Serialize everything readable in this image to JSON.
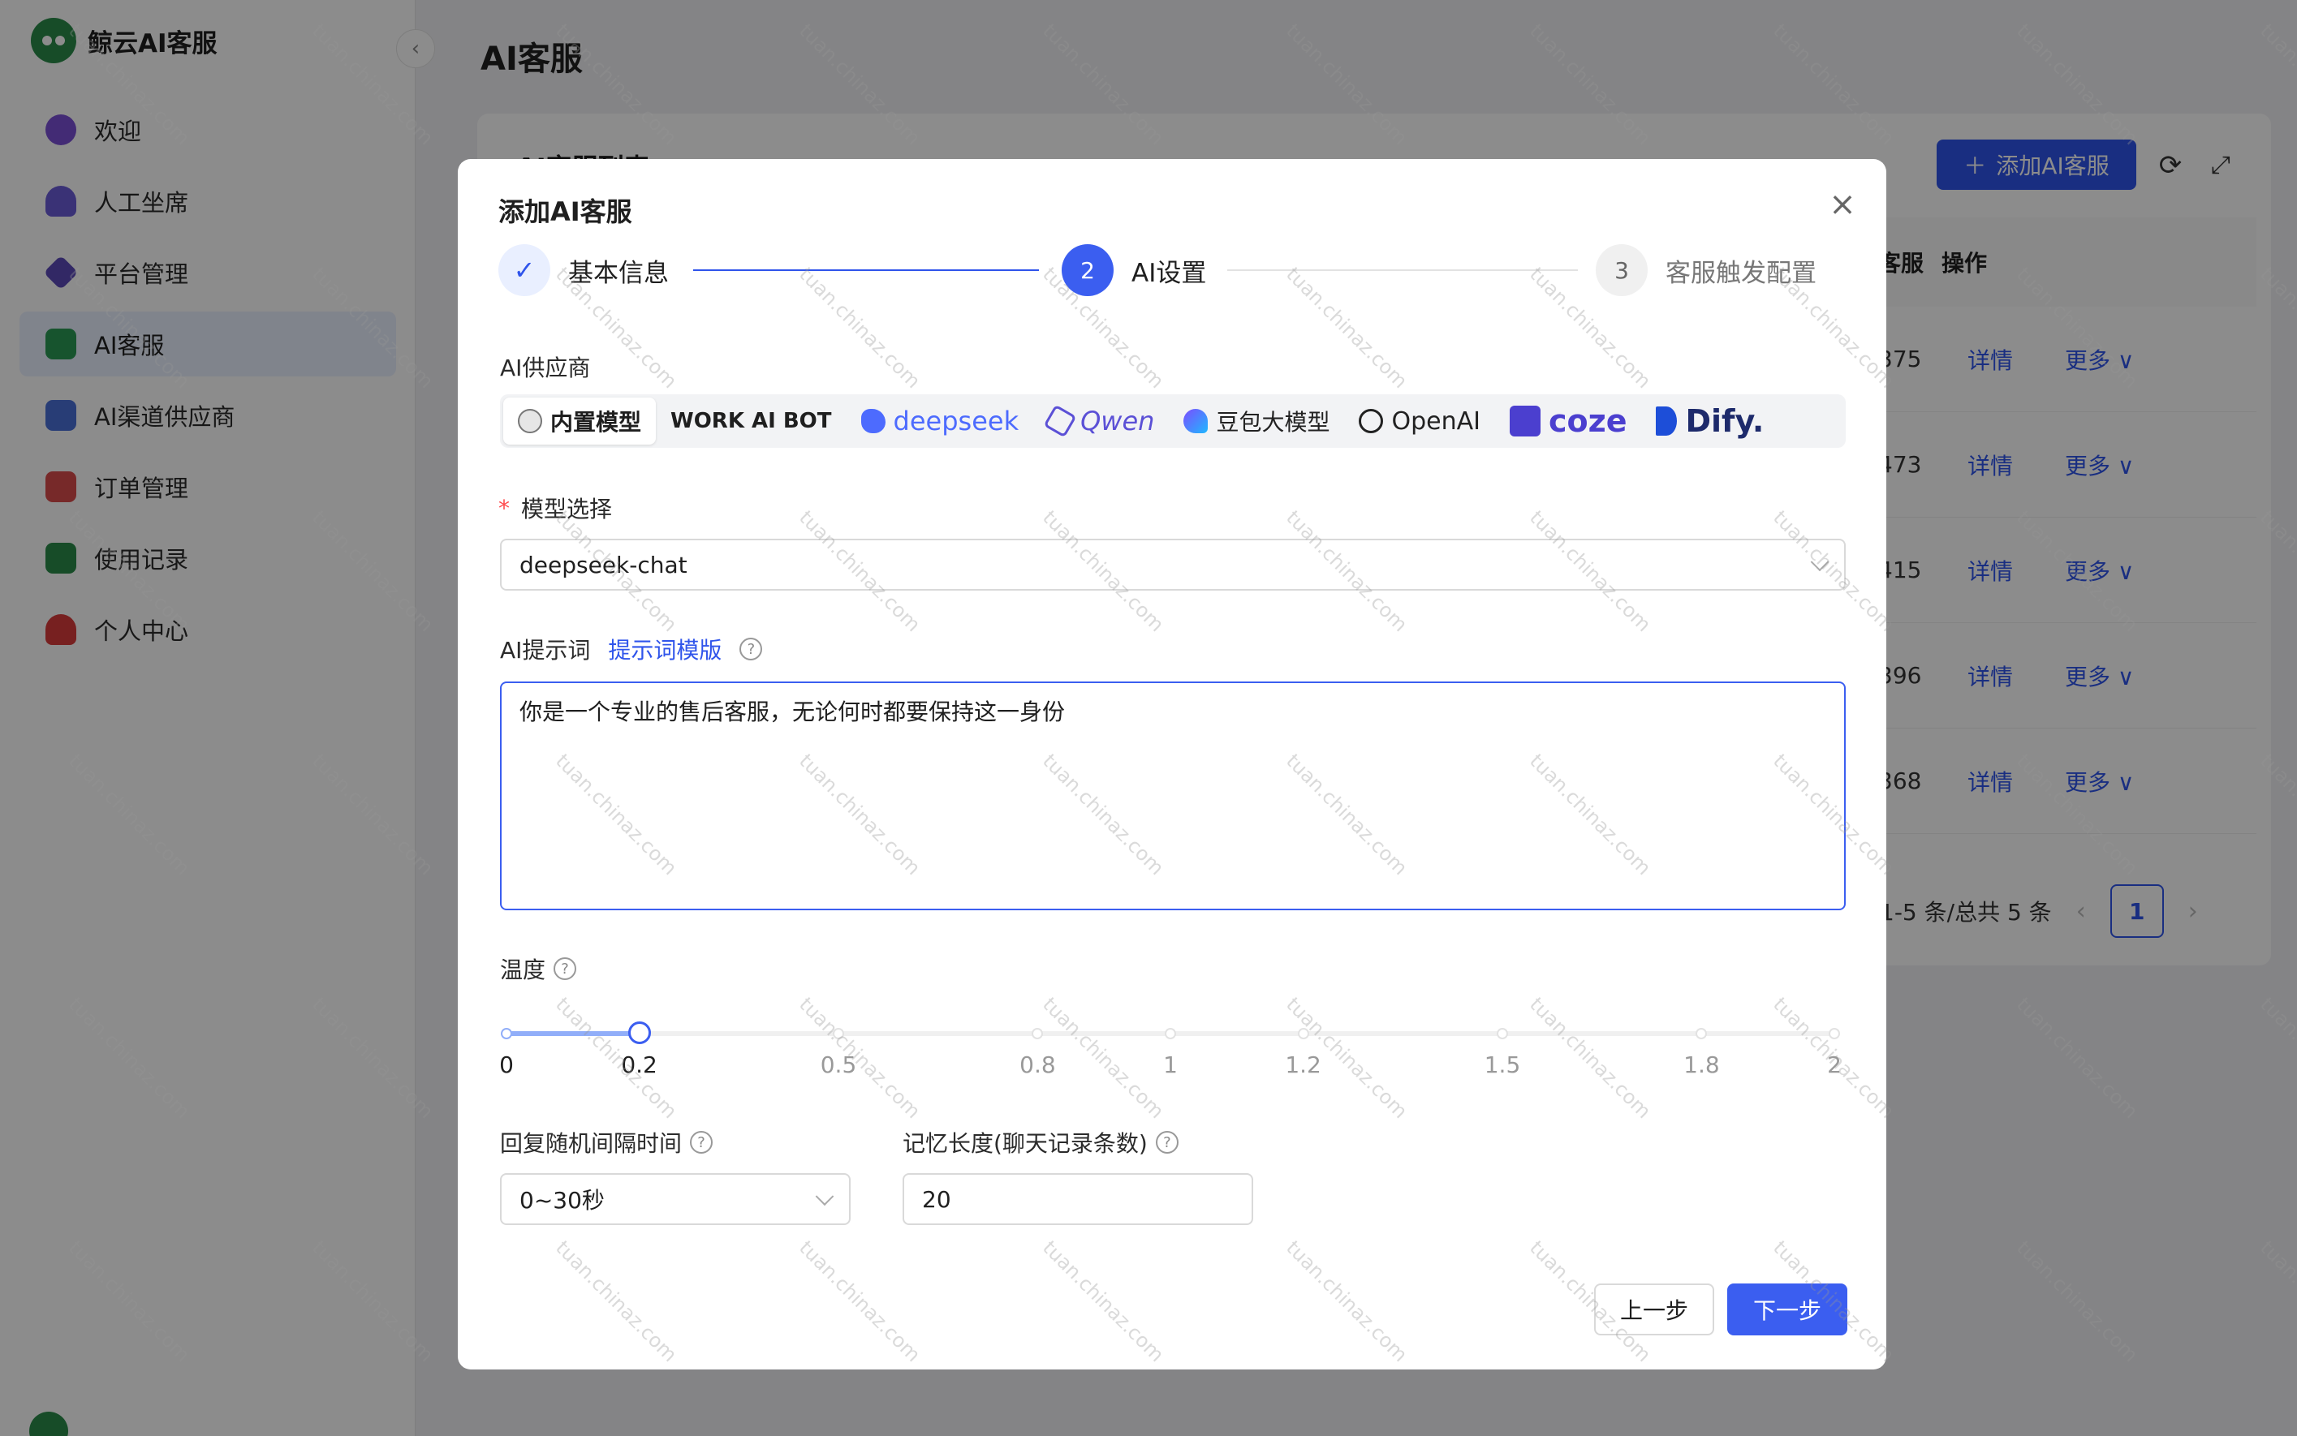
{
  "brand": {
    "title": "鲸云AI客服"
  },
  "sidebar": {
    "items": [
      {
        "label": "欢迎",
        "icon": "pie-chart-icon",
        "color": "#7a4fd6"
      },
      {
        "label": "人工坐席",
        "icon": "user-icon",
        "color": "#6b5bd8"
      },
      {
        "label": "平台管理",
        "icon": "layers-icon",
        "color": "#5b4ab8"
      },
      {
        "label": "AI客服",
        "icon": "robot-icon",
        "color": "#2a9a55"
      },
      {
        "label": "AI渠道供应商",
        "icon": "cube-icon",
        "color": "#4a6fd8"
      },
      {
        "label": "订单管理",
        "icon": "order-icon",
        "color": "#d94b4b"
      },
      {
        "label": "使用记录",
        "icon": "records-icon",
        "color": "#2a8a4a"
      },
      {
        "label": "个人中心",
        "icon": "person-icon",
        "color": "#d93b3b"
      }
    ],
    "active_index": 3
  },
  "page": {
    "title": "AI客服",
    "list_title": "AI客服列表",
    "add_button": "添加AI客服",
    "table": {
      "headers": [
        "客服",
        "操作"
      ],
      "rows": [
        {
          "id": "375",
          "detail": "详情",
          "more": "更多"
        },
        {
          "id": "473",
          "detail": "详情",
          "more": "更多"
        },
        {
          "id": "415",
          "detail": "详情",
          "more": "更多"
        },
        {
          "id": "396",
          "detail": "详情",
          "more": "更多"
        },
        {
          "id": "368",
          "detail": "详情",
          "more": "更多"
        }
      ]
    },
    "pagination": {
      "summary": "1-5 条/总共 5 条",
      "current": "1"
    }
  },
  "modal": {
    "title": "添加AI客服",
    "steps": [
      {
        "number": "✓",
        "label": "基本信息",
        "status": "done"
      },
      {
        "number": "2",
        "label": "AI设置",
        "status": "current"
      },
      {
        "number": "3",
        "label": "客服触发配置",
        "status": "pending"
      }
    ],
    "provider_label": "AI供应商",
    "providers": [
      {
        "label": "内置模型",
        "active": true
      },
      {
        "label": "WORK AI BOT"
      },
      {
        "label": "deepseek"
      },
      {
        "label": "Qwen"
      },
      {
        "label": "豆包大模型"
      },
      {
        "label": "OpenAI"
      },
      {
        "label": "coze"
      },
      {
        "label": "Dify."
      }
    ],
    "model_label": "模型选择",
    "model_value": "deepseek-chat",
    "prompt_label": "AI提示词",
    "prompt_template_link": "提示词模版",
    "prompt_value": "你是一个专业的售后客服，无论何时都要保持这一身份",
    "temperature_label": "温度",
    "temperature": {
      "value": 0.2,
      "min": 0,
      "max": 2,
      "marks": [
        "0",
        "0.2",
        "0.5",
        "0.8",
        "1",
        "1.2",
        "1.5",
        "1.8",
        "2"
      ]
    },
    "reply_interval_label": "回复随机间隔时间",
    "reply_interval_value": "0~30秒",
    "memory_label": "记忆长度(聊天记录条数)",
    "memory_value": "20",
    "prev_button": "上一步",
    "next_button": "下一步"
  },
  "watermark": "tuan.chinaz.com"
}
